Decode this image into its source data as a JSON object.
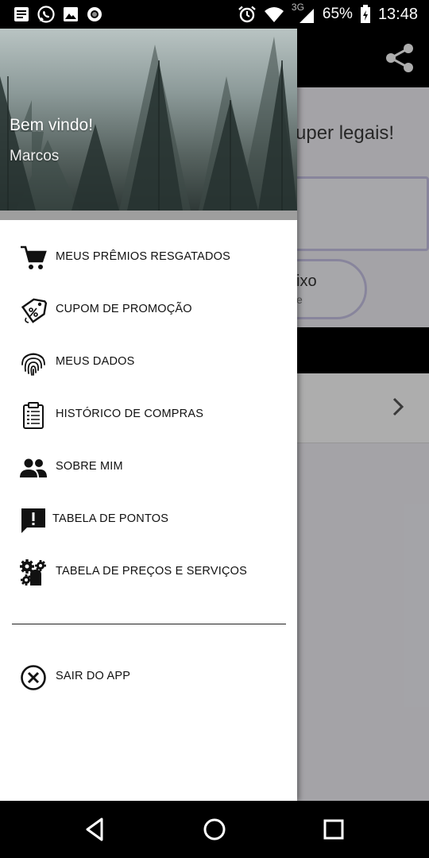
{
  "status_bar": {
    "network": "3G",
    "battery": "65%",
    "time": "13:48",
    "icons": [
      "message-icon",
      "whatsapp-icon",
      "image-icon",
      "record-icon",
      "alarm-icon",
      "wifi-icon",
      "signal-icon",
      "battery-icon"
    ]
  },
  "app": {
    "promo_text": "super legais!",
    "pill_text": "ixo",
    "pill_sub": "e"
  },
  "drawer": {
    "welcome": "Bem vindo!",
    "username": "Marcos",
    "items": [
      {
        "label": "MEUS PRÊMIOS RESGATADOS",
        "icon": "cart-icon"
      },
      {
        "label": "CUPOM DE PROMOÇÃO",
        "icon": "coupon-tag-icon"
      },
      {
        "label": "MEUS DADOS",
        "icon": "fingerprint-icon"
      },
      {
        "label": "HISTÓRICO DE COMPRAS",
        "icon": "clipboard-list-icon"
      },
      {
        "label": "SOBRE MIM",
        "icon": "people-icon"
      },
      {
        "label": "TABELA DE PONTOS",
        "icon": "alert-message-icon"
      },
      {
        "label": "TABELA DE PREÇOS E SERVIÇOS",
        "icon": "gears-person-icon"
      }
    ],
    "logout": {
      "label": "SAIR DO APP",
      "icon": "close-circle-icon"
    }
  },
  "nav_bar": {
    "buttons": [
      "back-icon",
      "home-icon",
      "recents-icon"
    ]
  }
}
